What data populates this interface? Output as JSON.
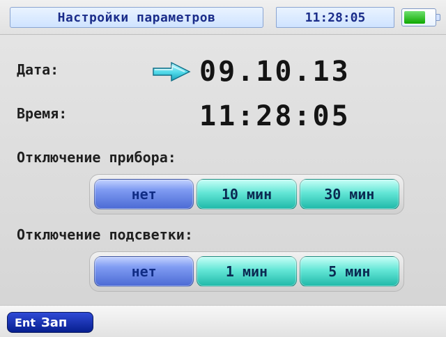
{
  "header": {
    "title": "Настройки параметров",
    "time": "11:28:05",
    "battery_level": 0.72,
    "battery_fill_color": "#0ea800"
  },
  "main": {
    "date_label": "Дата:",
    "date_value": "09.10.13",
    "time_label": "Время:",
    "time_value": "11:28:05",
    "device_shutdown_label": "Отключение прибора:",
    "device_shutdown_options": [
      "нет",
      "10 мин",
      "30 мин"
    ],
    "device_shutdown_selected": "нет",
    "backlight_shutdown_label": "Отключение подсветки:",
    "backlight_shutdown_options": [
      "нет",
      "1 мин",
      "5 мин"
    ],
    "backlight_shutdown_selected": "нет",
    "pointer_icon": "arrow-right-icon",
    "accent_colors": {
      "selected": "#4b6ad4",
      "unselected": "#1fb8a8"
    }
  },
  "footer": {
    "key_label": "Ent",
    "action_label": "Зап"
  }
}
